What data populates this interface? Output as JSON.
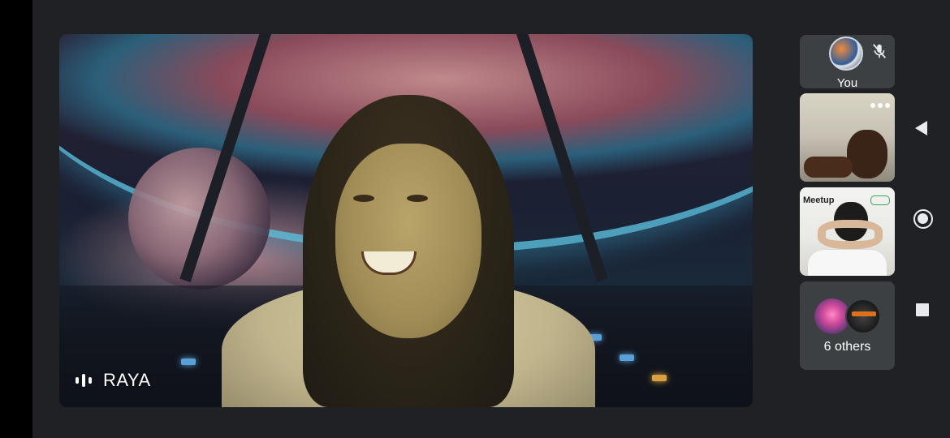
{
  "main_tile": {
    "participant_name": "RAYA",
    "audio_indicator_icon": "audio-level-icon",
    "background_scene": "space-cockpit-virtual-background"
  },
  "sidebar": {
    "self_tile": {
      "label": "You",
      "avatar_icon": "avatar-icon",
      "mic_icon": "mic-off-icon"
    },
    "participant_tiles": [
      {
        "more_icon": "more-options-icon"
      },
      {
        "overlay_text": "Meetup",
        "badge_icon": "toggle-badge-icon"
      }
    ],
    "others_tile": {
      "label": "6 others"
    }
  },
  "nav_bar": {
    "back_icon": "back-icon",
    "home_icon": "home-icon",
    "recents_icon": "recents-icon"
  },
  "colors": {
    "background": "#202124",
    "tile": "#3c4043",
    "text": "#ffffff"
  }
}
